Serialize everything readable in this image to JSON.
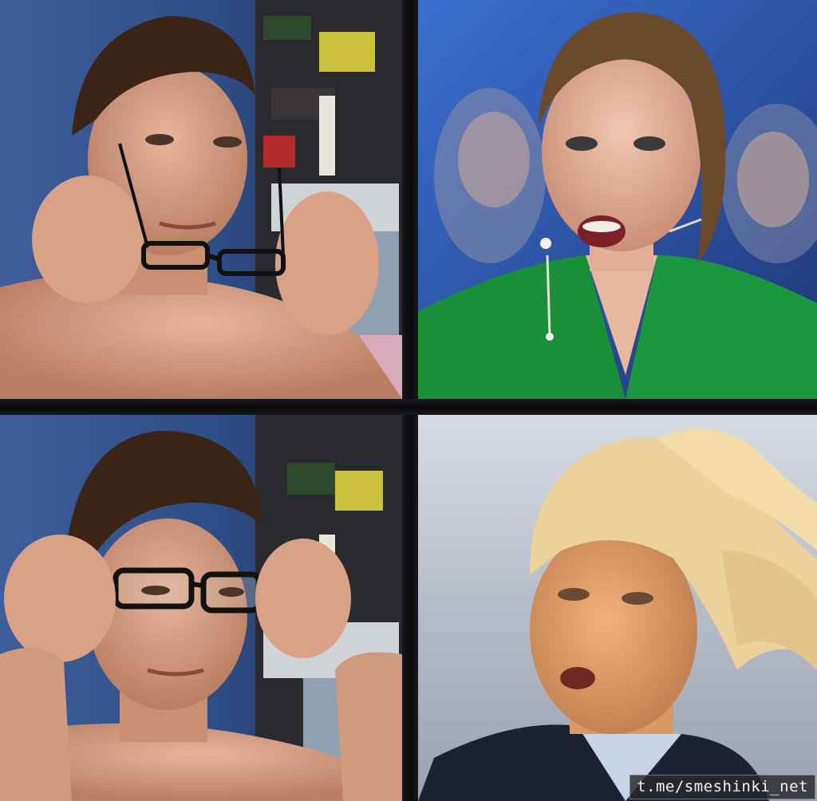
{
  "meme": {
    "watermark": "t.me/smeshinki_net",
    "panels": [
      {
        "position": "top-left",
        "subject": "shirtless young man lowering glasses from his face"
      },
      {
        "position": "top-right",
        "subject": "woman in green blazer with surprised open-mouthed expression"
      },
      {
        "position": "bottom-left",
        "subject": "shirtless young man putting glasses on"
      },
      {
        "position": "bottom-right",
        "subject": "man with windblown blond hair, mouth open"
      }
    ]
  }
}
